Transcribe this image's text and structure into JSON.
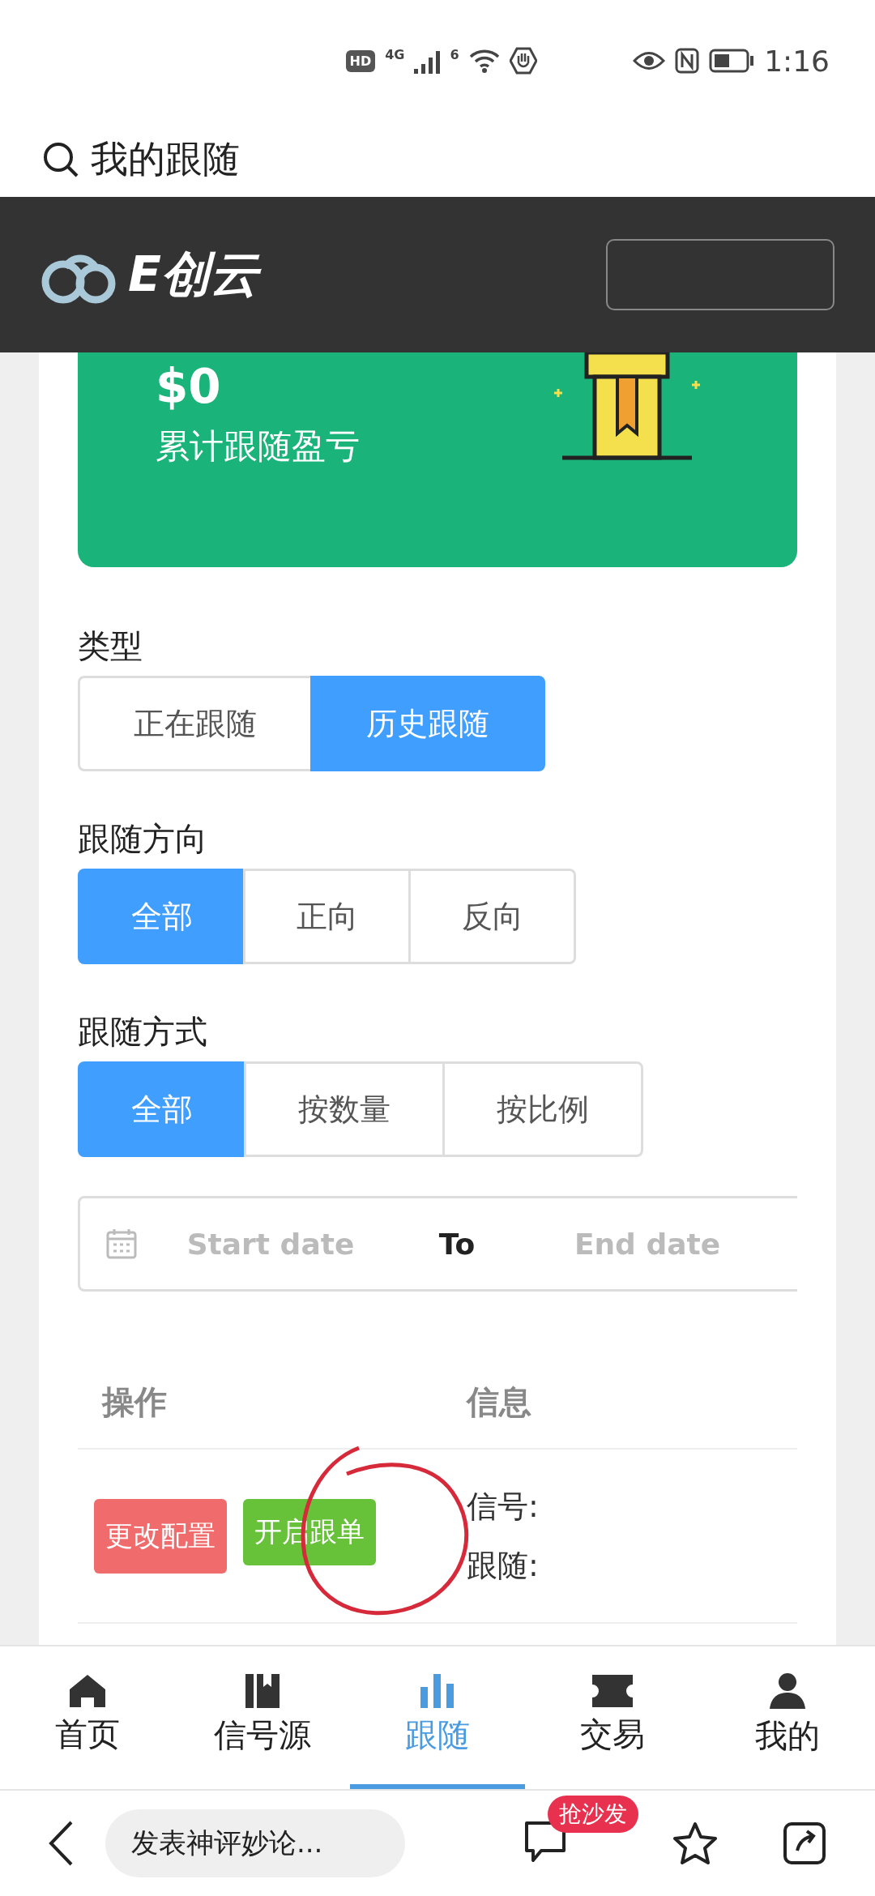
{
  "status_bar": {
    "hd": "HD",
    "network": "4G",
    "wifi_generation": "6",
    "time": "1:16"
  },
  "search": {
    "value": "我的跟随"
  },
  "brand": {
    "name": "E创云"
  },
  "summary": {
    "amount": "$0",
    "label": "累计跟随盈亏"
  },
  "filters": [
    {
      "label": "类型",
      "options": [
        {
          "label": "正在跟随",
          "selected": false
        },
        {
          "label": "历史跟随",
          "selected": true
        }
      ]
    },
    {
      "label": "跟随方向",
      "options": [
        {
          "label": "全部",
          "selected": true
        },
        {
          "label": "正向",
          "selected": false
        },
        {
          "label": "反向",
          "selected": false
        }
      ]
    },
    {
      "label": "跟随方式",
      "options": [
        {
          "label": "全部",
          "selected": true
        },
        {
          "label": "按数量",
          "selected": false
        },
        {
          "label": "按比例",
          "selected": false
        }
      ]
    }
  ],
  "date_range": {
    "start_placeholder": "Start date",
    "separator": "To",
    "end_placeholder": "End date"
  },
  "table": {
    "columns": [
      "操作",
      "信息"
    ],
    "rows": [
      {
        "actions": [
          {
            "label": "更改配置",
            "kind": "danger"
          },
          {
            "label": "开启跟单",
            "kind": "success"
          }
        ],
        "info": [
          "信号:",
          "跟随:"
        ]
      }
    ]
  },
  "tab_bar": [
    {
      "label": "首页",
      "selected": false
    },
    {
      "label": "信号源",
      "selected": false
    },
    {
      "label": "跟随",
      "selected": true
    },
    {
      "label": "交易",
      "selected": false
    },
    {
      "label": "我的",
      "selected": false
    }
  ],
  "comment_bar": {
    "placeholder": "发表神评妙论...",
    "badge": "抢沙发"
  }
}
